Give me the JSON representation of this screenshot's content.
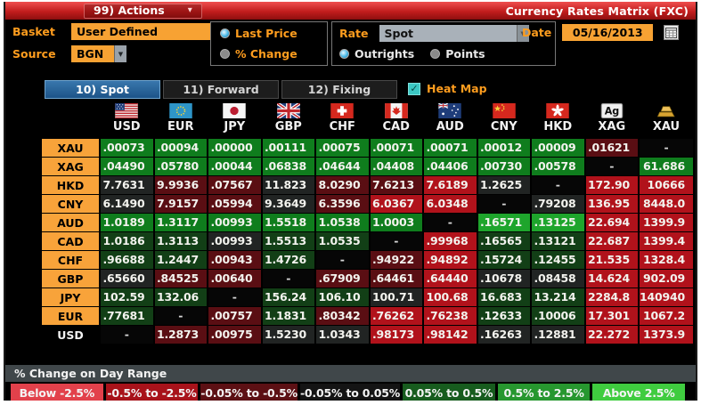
{
  "title_bar": {
    "actions_label": "99) Actions",
    "title": "Currency Rates Matrix (FXC)"
  },
  "controls": {
    "basket_label": "Basket",
    "basket_value": "User Defined",
    "source_label": "Source",
    "source_value": "BGN",
    "price_mode": {
      "options": [
        {
          "label": "Last Price",
          "selected": true
        },
        {
          "label": "% Change",
          "selected": false
        }
      ]
    },
    "rate_label": "Rate",
    "rate_value": "Spot",
    "rate_mode": {
      "options": [
        {
          "label": "Outrights",
          "selected": true
        },
        {
          "label": "Points",
          "selected": false
        }
      ]
    },
    "date_label": "Date",
    "date_value": "05/16/2013",
    "calendar_icon": "calendar-icon"
  },
  "tabs": [
    {
      "label": "10) Spot",
      "selected": true
    },
    {
      "label": "11) Forward",
      "selected": false
    },
    {
      "label": "12) Fixing",
      "selected": false
    }
  ],
  "heat_map": {
    "label": "Heat Map",
    "checked": true
  },
  "matrix": {
    "columns": [
      {
        "code": "USD",
        "flag": "us"
      },
      {
        "code": "EUR",
        "flag": "eu"
      },
      {
        "code": "JPY",
        "flag": "jp"
      },
      {
        "code": "GBP",
        "flag": "gb"
      },
      {
        "code": "CHF",
        "flag": "ch"
      },
      {
        "code": "CAD",
        "flag": "ca"
      },
      {
        "code": "AUD",
        "flag": "au"
      },
      {
        "code": "CNY",
        "flag": "cn"
      },
      {
        "code": "HKD",
        "flag": "hk"
      },
      {
        "code": "XAG",
        "flag": "xag"
      },
      {
        "code": "XAU",
        "flag": "xau"
      }
    ],
    "rows": [
      {
        "label": "XAU",
        "plain": false,
        "cells": [
          [
            ".00073",
            "g2"
          ],
          [
            ".00094",
            "g2"
          ],
          [
            ".00000",
            "g2"
          ],
          [
            ".00111",
            "g2"
          ],
          [
            ".00075",
            "g2"
          ],
          [
            ".00071",
            "g2"
          ],
          [
            ".00071",
            "g2"
          ],
          [
            ".00012",
            "g2"
          ],
          [
            ".00009",
            "g2"
          ],
          [
            ".01621",
            "r3"
          ],
          [
            "-",
            "b"
          ]
        ]
      },
      {
        "label": "XAG",
        "plain": false,
        "cells": [
          [
            ".04490",
            "g2"
          ],
          [
            ".05780",
            "g2"
          ],
          [
            ".00044",
            "g2"
          ],
          [
            ".06838",
            "g2"
          ],
          [
            ".04644",
            "g2"
          ],
          [
            ".04408",
            "g2"
          ],
          [
            ".04406",
            "g2"
          ],
          [
            ".00730",
            "g2"
          ],
          [
            ".00578",
            "g2"
          ],
          [
            "-",
            "b"
          ],
          [
            "61.686",
            "g2"
          ]
        ]
      },
      {
        "label": "HKD",
        "plain": false,
        "cells": [
          [
            "7.7631",
            "k"
          ],
          [
            "9.9936",
            "r3"
          ],
          [
            ".07567",
            "r3"
          ],
          [
            "11.823",
            "k"
          ],
          [
            "8.0290",
            "r3"
          ],
          [
            "7.6213",
            "r3"
          ],
          [
            "7.6189",
            "r2"
          ],
          [
            "1.2625",
            "k"
          ],
          [
            "-",
            "b"
          ],
          [
            "172.90",
            "r2"
          ],
          [
            "10666",
            "r2"
          ]
        ]
      },
      {
        "label": "CNY",
        "plain": false,
        "cells": [
          [
            "6.1490",
            "k"
          ],
          [
            "7.9157",
            "r3"
          ],
          [
            ".05994",
            "r3"
          ],
          [
            "9.3649",
            "k"
          ],
          [
            "6.3596",
            "r3"
          ],
          [
            "6.0367",
            "r2"
          ],
          [
            "6.0348",
            "r2"
          ],
          [
            "-",
            "b"
          ],
          [
            ".79208",
            "k"
          ],
          [
            "136.95",
            "r2"
          ],
          [
            "8448.0",
            "r2"
          ]
        ]
      },
      {
        "label": "AUD",
        "plain": false,
        "cells": [
          [
            "1.0189",
            "g2"
          ],
          [
            "1.3117",
            "g2"
          ],
          [
            ".00993",
            "g2"
          ],
          [
            "1.5518",
            "g2"
          ],
          [
            "1.0538",
            "g2"
          ],
          [
            "1.0003",
            "g2"
          ],
          [
            "-",
            "b"
          ],
          [
            ".16571",
            "g1"
          ],
          [
            ".13125",
            "g1"
          ],
          [
            "22.694",
            "r2"
          ],
          [
            "1399.9",
            "r2"
          ]
        ]
      },
      {
        "label": "CAD",
        "plain": false,
        "cells": [
          [
            "1.0186",
            "g3"
          ],
          [
            "1.3113",
            "g3"
          ],
          [
            ".00993",
            "k"
          ],
          [
            "1.5513",
            "g3"
          ],
          [
            "1.0535",
            "g3"
          ],
          [
            "-",
            "b"
          ],
          [
            ".99968",
            "r2"
          ],
          [
            ".16565",
            "g3"
          ],
          [
            ".13121",
            "g3"
          ],
          [
            "22.687",
            "r2"
          ],
          [
            "1399.4",
            "r2"
          ]
        ]
      },
      {
        "label": "CHF",
        "plain": false,
        "cells": [
          [
            ".96688",
            "g3"
          ],
          [
            "1.2447",
            "g3"
          ],
          [
            ".00943",
            "r3"
          ],
          [
            "1.4726",
            "g3"
          ],
          [
            "-",
            "b"
          ],
          [
            ".94922",
            "r3"
          ],
          [
            ".94892",
            "r2"
          ],
          [
            ".15724",
            "g3"
          ],
          [
            ".12455",
            "g3"
          ],
          [
            "21.535",
            "r2"
          ],
          [
            "1328.4",
            "r2"
          ]
        ]
      },
      {
        "label": "GBP",
        "plain": false,
        "cells": [
          [
            ".65660",
            "k"
          ],
          [
            ".84525",
            "r3"
          ],
          [
            ".00640",
            "r3"
          ],
          [
            "-",
            "b"
          ],
          [
            ".67909",
            "r3"
          ],
          [
            ".64461",
            "r3"
          ],
          [
            ".64440",
            "r2"
          ],
          [
            ".10678",
            "k"
          ],
          [
            ".08458",
            "k"
          ],
          [
            "14.624",
            "r2"
          ],
          [
            "902.09",
            "r2"
          ]
        ]
      },
      {
        "label": "JPY",
        "plain": false,
        "cells": [
          [
            "102.59",
            "g3"
          ],
          [
            "132.06",
            "g3"
          ],
          [
            "-",
            "b"
          ],
          [
            "156.24",
            "g3"
          ],
          [
            "106.10",
            "g3"
          ],
          [
            "100.71",
            "k"
          ],
          [
            "100.68",
            "r2"
          ],
          [
            "16.683",
            "g3"
          ],
          [
            "13.214",
            "g3"
          ],
          [
            "2284.8",
            "r2"
          ],
          [
            "140940",
            "r2"
          ]
        ]
      },
      {
        "label": "EUR",
        "plain": false,
        "cells": [
          [
            ".77681",
            "g3"
          ],
          [
            "-",
            "b"
          ],
          [
            ".00757",
            "r3"
          ],
          [
            "1.1831",
            "g3"
          ],
          [
            ".80342",
            "r3"
          ],
          [
            ".76262",
            "r2"
          ],
          [
            ".76238",
            "r2"
          ],
          [
            ".12633",
            "g3"
          ],
          [
            ".10006",
            "g3"
          ],
          [
            "17.301",
            "r2"
          ],
          [
            "1067.2",
            "r2"
          ]
        ]
      },
      {
        "label": "USD",
        "plain": true,
        "cells": [
          [
            "-",
            "b"
          ],
          [
            "1.2873",
            "r3"
          ],
          [
            ".00975",
            "r3"
          ],
          [
            "1.5230",
            "k"
          ],
          [
            "1.0343",
            "k"
          ],
          [
            ".98173",
            "r2"
          ],
          [
            ".98142",
            "r2"
          ],
          [
            ".16263",
            "k"
          ],
          [
            ".12881",
            "k"
          ],
          [
            "22.272",
            "r2"
          ],
          [
            "1373.9",
            "r2"
          ]
        ]
      }
    ]
  },
  "legend": {
    "header": "% Change on Day Range",
    "buckets": [
      {
        "label": "Below -2.5%",
        "color": "#e2414b"
      },
      {
        "label": "-0.5% to -2.5%",
        "color": "#a8121a"
      },
      {
        "label": "-0.05% to -0.5%",
        "color": "#5c1014"
      },
      {
        "label": "-0.05% to 0.05%",
        "color": "#141414"
      },
      {
        "label": "0.05% to 0.5%",
        "color": "#175c1e"
      },
      {
        "label": "0.5% to 2.5%",
        "color": "#27972f"
      },
      {
        "label": "Above 2.5%",
        "color": "#3fcc3f"
      }
    ]
  },
  "colors": {
    "amber": "#f7a233",
    "amber_text": "#ff9d1e",
    "titlebar_red": "#c21d1d",
    "tab_selected_blue": "#1d5488",
    "heat_checkbox_teal": "#3cc8c4",
    "heat_green_bright": "#1ea52c",
    "heat_green_mid": "#0f7d1d",
    "heat_green_dark": "#123f16",
    "heat_neutral": "#212423",
    "heat_red_dark": "#5a0e13",
    "heat_red_mid": "#b1121b"
  }
}
